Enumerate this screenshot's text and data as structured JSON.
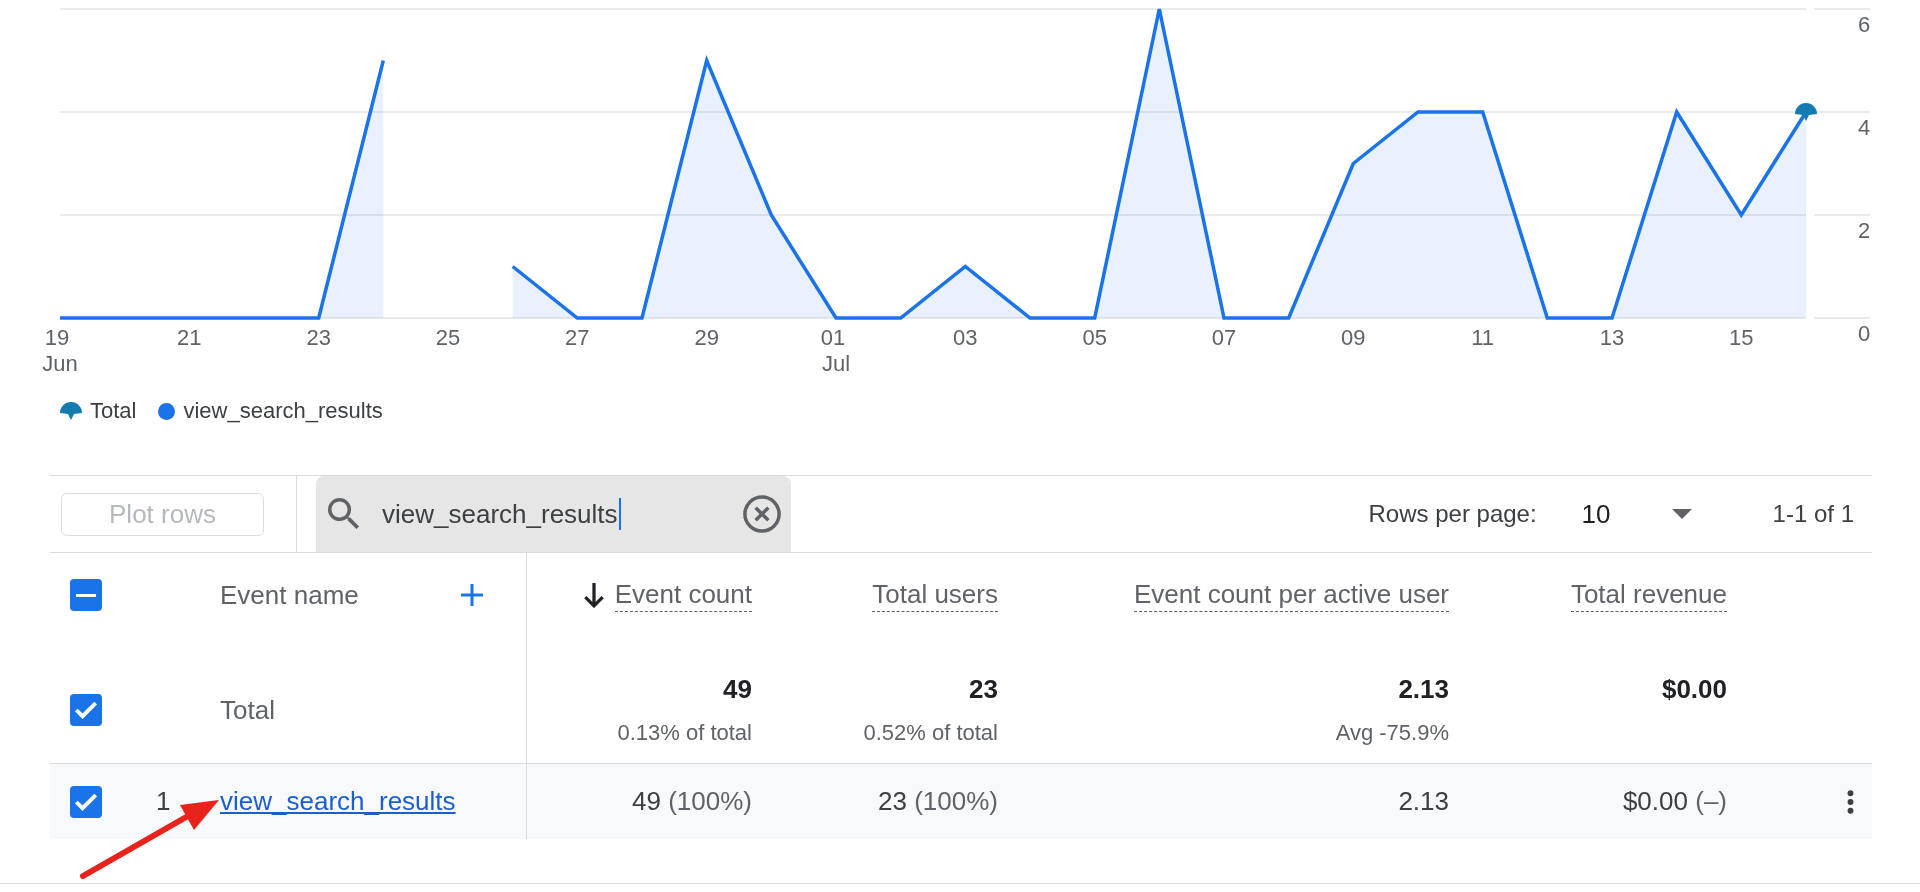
{
  "chart": {
    "chart_data": {
      "type": "area",
      "categories": [
        "19 Jun",
        null,
        "21",
        null,
        "23",
        null,
        "25",
        null,
        "27",
        null,
        "29",
        null,
        "01 Jul",
        null,
        "03",
        null,
        "05",
        null,
        "07",
        null,
        "09",
        null,
        "11",
        null,
        "13",
        null,
        "15",
        null
      ],
      "ylim": [
        0,
        6
      ],
      "yticks": [
        0,
        2,
        4,
        6
      ],
      "grid": true,
      "legend": "bottom",
      "series": [
        {
          "name": "view_search_results",
          "color": "#1a73e8",
          "values": [
            0,
            0,
            0,
            0,
            0,
            5,
            null,
            1,
            0,
            0,
            5,
            2,
            0,
            0,
            1,
            0,
            0,
            6,
            0,
            0,
            3,
            4,
            4,
            0,
            0,
            4,
            2,
            4
          ]
        }
      ]
    },
    "total": {
      "label": "Total",
      "color": "#137bb0"
    }
  },
  "table": {
    "toolbar": {
      "plot_rows": {
        "label": "Plot rows",
        "disabled": true
      },
      "search": {
        "value": "view_search_results",
        "focused": true
      },
      "rows_per_page_label": "Rows per page:",
      "rows_per_page": "10",
      "range": "1-1 of 1"
    },
    "header": {
      "select_all": {
        "indeterminate": true
      },
      "dimension": "Event name",
      "columns": [
        {
          "label": "Event count",
          "sorted": true
        },
        {
          "label": "Total users",
          "sorted": false
        },
        {
          "label": "Event count per active user",
          "sorted": false
        },
        {
          "label": "Total revenue",
          "sorted": false
        }
      ]
    },
    "total_row": {
      "checked": true,
      "label": "Total",
      "cells": [
        {
          "value": "49",
          "note": "0.13% of total"
        },
        {
          "value": "23",
          "note": "0.52% of total"
        },
        {
          "value": "2.13",
          "note": "Avg -75.9%"
        },
        {
          "value": "$0.00"
        }
      ]
    },
    "rows": [
      {
        "checked": true,
        "index": "1",
        "name": "view_search_results",
        "cells": [
          {
            "value": "49",
            "share": "(100%)"
          },
          {
            "value": "23",
            "share": "(100%)"
          },
          {
            "value": "2.13"
          },
          {
            "value": "$0.00",
            "share": "(–)"
          }
        ]
      }
    ]
  }
}
